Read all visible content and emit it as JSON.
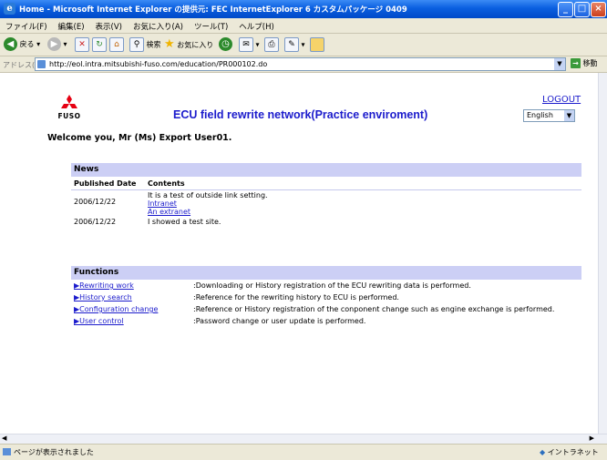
{
  "window": {
    "title": "Home - Microsoft Internet Explorer の提供元: FEC InternetExplorer 6 カスタムパッケージ 0409"
  },
  "menubar": [
    "ファイル(F)",
    "編集(E)",
    "表示(V)",
    "お気に入り(A)",
    "ツール(T)",
    "ヘルプ(H)"
  ],
  "toolbar": {
    "back": "戻る",
    "search": "検索",
    "favorites": "お気に入り"
  },
  "addressbar": {
    "label": "アドレス(D)",
    "url": "http://eol.intra.mitsubishi-fuso.com/education/PR000102.do",
    "go": "移動"
  },
  "header": {
    "brand": "FUSO",
    "title": "ECU field rewrite network(Practice enviroment)",
    "logout": "LOGOUT",
    "language": "English"
  },
  "welcome": "Welcome you, Mr (Ms) Export User01.",
  "news": {
    "heading": "News",
    "columns": [
      "Published Date",
      "Contents"
    ],
    "rows": [
      {
        "date": "2006/12/22",
        "text": "It is a test of outside link setting.",
        "links": [
          "Intranet",
          "An extranet"
        ]
      },
      {
        "date": "2006/12/22",
        "text": "I showed a test site.",
        "links": []
      }
    ]
  },
  "functions": {
    "heading": "Functions",
    "items": [
      {
        "label": "▶Rewriting work",
        "desc": ":Downloading or History registration of the ECU rewriting data is performed."
      },
      {
        "label": "▶History search",
        "desc": ":Reference for the rewriting history to ECU is performed."
      },
      {
        "label": "▶Configuration change",
        "desc": ":Reference or History registration of the conponent change such as engine exchange is performed."
      },
      {
        "label": "▶User control",
        "desc": ":Password change or user update is performed."
      }
    ]
  },
  "statusbar": {
    "left": "ページが表示されました",
    "zone": "イントラネット"
  },
  "colors": {
    "title_blue": "#1b1bcc",
    "section_header": "#cccff5",
    "mitsubishi_red": "#e60012"
  }
}
